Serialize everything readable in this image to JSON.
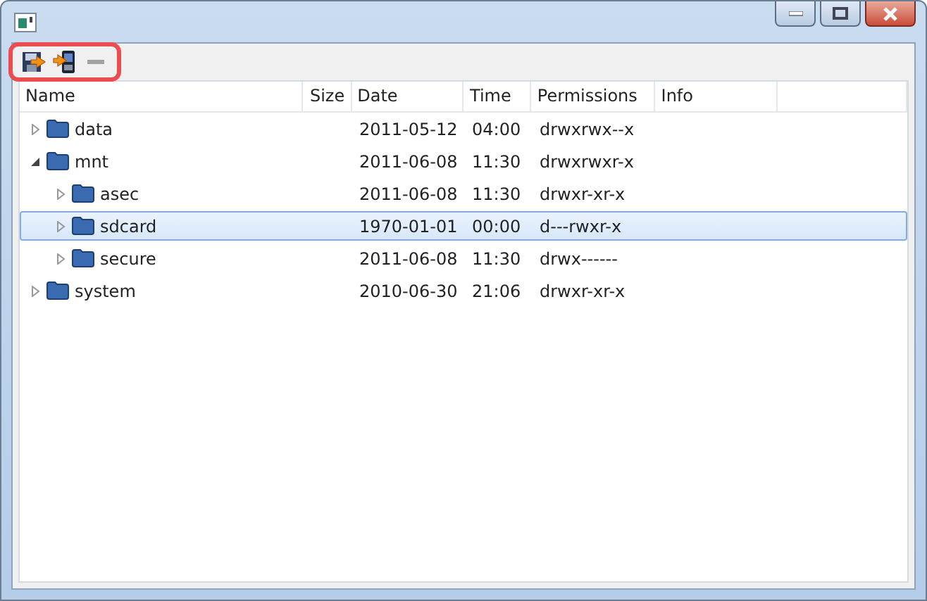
{
  "toolbar": [
    {
      "kind": "pull",
      "disabled": false
    },
    {
      "kind": "push",
      "disabled": false
    },
    {
      "kind": "delete",
      "disabled": true
    }
  ],
  "table": {
    "columns": [
      "Name",
      "Size",
      "Date",
      "Time",
      "Permissions",
      "Info"
    ],
    "rows": [
      {
        "name": "data",
        "date": "2011-05-12",
        "time": "04:00",
        "permissions": "drwxrwx--x",
        "expanded": false,
        "selected": false
      },
      {
        "name": "mnt",
        "date": "2011-06-08",
        "time": "11:30",
        "permissions": "drwxrwxr-x",
        "expanded": true,
        "selected": false,
        "children": [
          {
            "name": "asec",
            "date": "2011-06-08",
            "time": "11:30",
            "permissions": "drwxr-xr-x",
            "expanded": false,
            "selected": false
          },
          {
            "name": "sdcard",
            "date": "1970-01-01",
            "time": "00:00",
            "permissions": "d---rwxr-x",
            "expanded": false,
            "selected": true
          },
          {
            "name": "secure",
            "date": "2011-06-08",
            "time": "11:30",
            "permissions": "drwx------",
            "expanded": false,
            "selected": false
          }
        ]
      },
      {
        "name": "system",
        "date": "2010-06-30",
        "time": "21:06",
        "permissions": "drwxr-xr-x",
        "expanded": false,
        "selected": false
      }
    ]
  }
}
